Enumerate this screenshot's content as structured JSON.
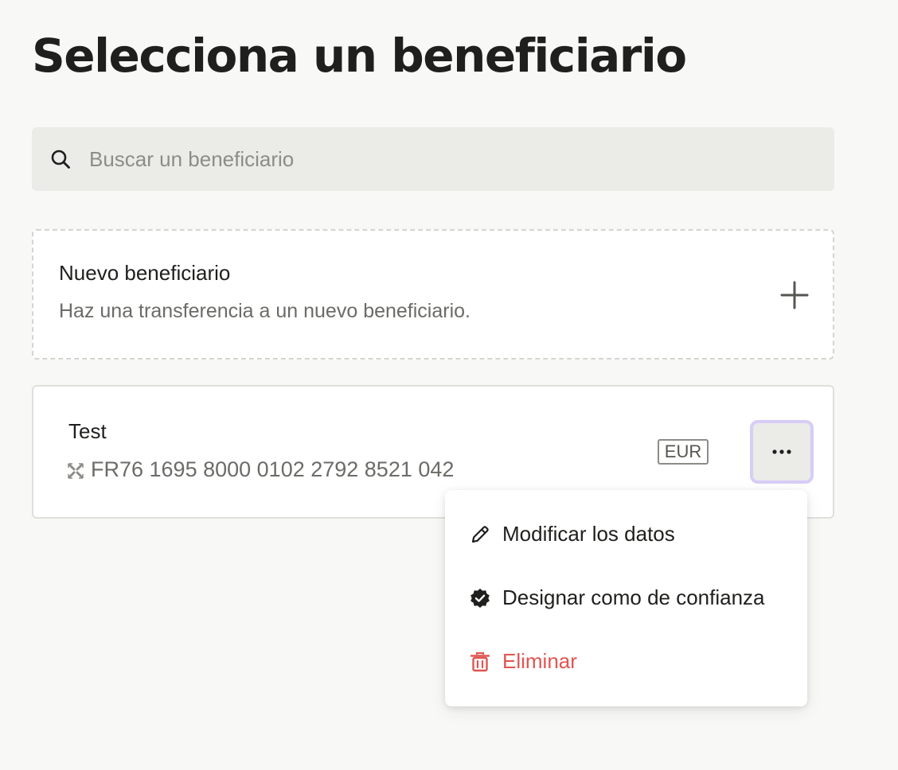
{
  "page": {
    "title": "Selecciona un beneficiario"
  },
  "search": {
    "placeholder": "Buscar un beneficiario",
    "value": "",
    "icon": "search-icon"
  },
  "new_beneficiary": {
    "title": "Nuevo beneficiario",
    "subtitle": "Haz una transferencia a un nuevo beneficiario.",
    "icon": "plus-icon"
  },
  "beneficiaries": [
    {
      "name": "Test",
      "iban": "FR76 1695 8000 0102 2792 8521 042",
      "currency": "EUR",
      "account_icon": "sepa-icon",
      "menu_icon": "more-horizontal-icon"
    }
  ],
  "menu": {
    "items": [
      {
        "label": "Modificar los datos",
        "icon": "pencil-icon"
      },
      {
        "label": "Designar como de confianza",
        "icon": "verified-badge-icon"
      },
      {
        "label": "Eliminar",
        "icon": "trash-icon",
        "danger": true
      }
    ]
  },
  "colors": {
    "background": "#f8f8f6",
    "text": "#1f1f1d",
    "muted_text": "#6b6b68",
    "search_bg": "#ebebe7",
    "focus_ring": "#d7cdf7",
    "danger": "#e05551"
  }
}
